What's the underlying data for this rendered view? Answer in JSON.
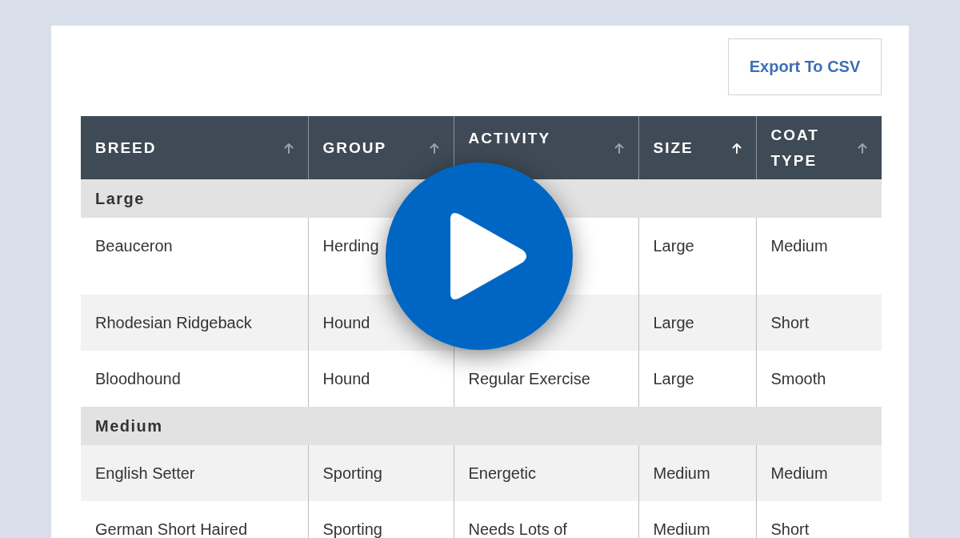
{
  "export_button": {
    "label": "Export To CSV"
  },
  "table": {
    "columns": [
      {
        "label": "BREED",
        "sort_active": false
      },
      {
        "label": "GROUP",
        "sort_active": false
      },
      {
        "label": "ACTIVITY",
        "sort_active": false
      },
      {
        "label": "SIZE",
        "sort_active": true
      },
      {
        "label": "COAT TYPE",
        "sort_active": false
      }
    ],
    "groups": [
      {
        "label": "Large",
        "rows": [
          [
            "Beauceron",
            "Herding",
            null,
            "Large",
            "Medium"
          ],
          [
            "Rhodesian Ridgeback",
            "Hound",
            null,
            "Large",
            "Short"
          ],
          [
            "Bloodhound",
            "Hound",
            "Regular Exercise",
            "Large",
            "Smooth"
          ]
        ]
      },
      {
        "label": "Medium",
        "rows": [
          [
            "English Setter",
            "Sporting",
            "Energetic",
            "Medium",
            "Medium"
          ],
          [
            "German Short Haired",
            "Sporting",
            "Needs Lots of",
            "Medium",
            "Short"
          ]
        ]
      }
    ]
  }
}
